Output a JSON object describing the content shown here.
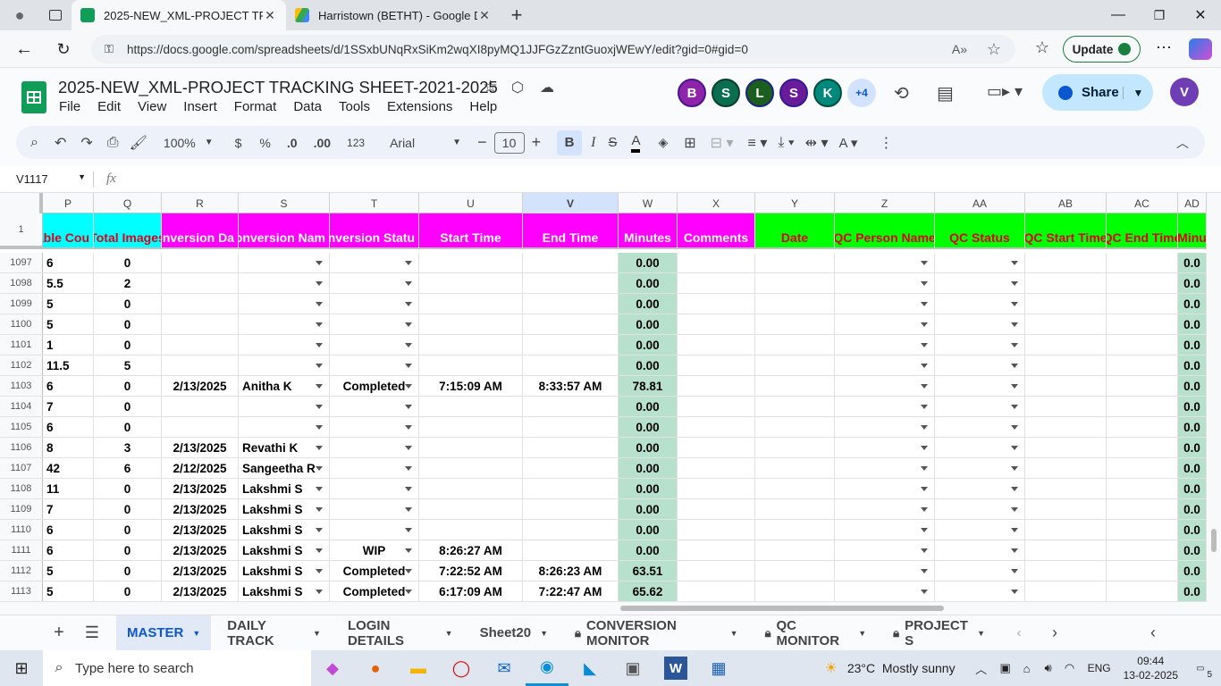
{
  "browser": {
    "tabs": [
      {
        "title": "2025-NEW_XML-PROJECT TRACK",
        "active": true
      },
      {
        "title": "Harristown (BETHT) - Google Driv",
        "active": false
      }
    ],
    "url": "https://docs.google.com/spreadsheets/d/1SSxbUNqRxSiKm2wqXI8pyMQ1JJFGzZzntGuoxjWEwY/edit?gid=0#gid=0",
    "update_label": "Update"
  },
  "doc": {
    "title": "2025-NEW_XML-PROJECT TRACKING SHEET-2021-2025",
    "menu": [
      "File",
      "Edit",
      "View",
      "Insert",
      "Format",
      "Data",
      "Tools",
      "Extensions",
      "Help"
    ],
    "collaborators": [
      {
        "initial": "B",
        "color": "#8e24aa"
      },
      {
        "initial": "S",
        "color": "#0b6e4f"
      },
      {
        "initial": "L",
        "color": "#1b5e20"
      },
      {
        "initial": "S",
        "color": "#6a1b9a"
      },
      {
        "initial": "K",
        "color": "#00897b"
      }
    ],
    "more_collaborators": "+4",
    "share_label": "Share",
    "user_initial": "V"
  },
  "toolbar": {
    "zoom": "100%",
    "currency": "$",
    "percent": "%",
    "dec_less": ".0",
    "dec_more": ".00",
    "number_format": "123",
    "font": "Arial",
    "font_size": "10"
  },
  "formula_bar": {
    "cell_ref": "V1117",
    "fx": "fx",
    "value": ""
  },
  "grid": {
    "columns": [
      "P",
      "Q",
      "R",
      "S",
      "T",
      "U",
      "V",
      "W",
      "X",
      "Y",
      "Z",
      "AA",
      "AB",
      "AC",
      "AD"
    ],
    "header_row_num": "1",
    "headers": [
      "able Cou",
      "Total Images",
      "onversion Da",
      "onversion Nam",
      "onversion Statu",
      "Start Time",
      "End Time",
      "Minutes",
      "Comments",
      "Date",
      "QC Person Name",
      "QC Status",
      "QC Start Time",
      "QC End Time",
      "Minu"
    ],
    "rows": [
      {
        "n": "1097",
        "P": "6",
        "Q": "0",
        "R": "",
        "S": "",
        "T": "",
        "U": "",
        "V": "",
        "W": "0.00",
        "AD": "0.0"
      },
      {
        "n": "1098",
        "P": "5.5",
        "Q": "2",
        "R": "",
        "S": "",
        "T": "",
        "U": "",
        "V": "",
        "W": "0.00",
        "AD": "0.0"
      },
      {
        "n": "1099",
        "P": "5",
        "Q": "0",
        "R": "",
        "S": "",
        "T": "",
        "U": "",
        "V": "",
        "W": "0.00",
        "AD": "0.0"
      },
      {
        "n": "1100",
        "P": "5",
        "Q": "0",
        "R": "",
        "S": "",
        "T": "",
        "U": "",
        "V": "",
        "W": "0.00",
        "AD": "0.0"
      },
      {
        "n": "1101",
        "P": "1",
        "Q": "0",
        "R": "",
        "S": "",
        "T": "",
        "U": "",
        "V": "",
        "W": "0.00",
        "AD": "0.0"
      },
      {
        "n": "1102",
        "P": "11.5",
        "Q": "5",
        "R": "",
        "S": "",
        "T": "",
        "U": "",
        "V": "",
        "W": "0.00",
        "AD": "0.0"
      },
      {
        "n": "1103",
        "P": "6",
        "Q": "0",
        "R": "2/13/2025",
        "S": "Anitha K",
        "T": "Completed",
        "U": "7:15:09 AM",
        "V": "8:33:57 AM",
        "W": "78.81",
        "AD": "0.0"
      },
      {
        "n": "1104",
        "P": "7",
        "Q": "0",
        "R": "",
        "S": "",
        "T": "",
        "U": "",
        "V": "",
        "W": "0.00",
        "AD": "0.0"
      },
      {
        "n": "1105",
        "P": "6",
        "Q": "0",
        "R": "",
        "S": "",
        "T": "",
        "U": "",
        "V": "",
        "W": "0.00",
        "AD": "0.0"
      },
      {
        "n": "1106",
        "P": "8",
        "Q": "3",
        "R": "2/13/2025",
        "S": "Revathi K",
        "T": "",
        "U": "",
        "V": "",
        "W": "0.00",
        "AD": "0.0"
      },
      {
        "n": "1107",
        "P": "42",
        "Q": "6",
        "R": "2/12/2025",
        "S": "Sangeetha R",
        "T": "",
        "U": "",
        "V": "",
        "W": "0.00",
        "AD": "0.0"
      },
      {
        "n": "1108",
        "P": "11",
        "Q": "0",
        "R": "2/13/2025",
        "S": "Lakshmi S",
        "T": "",
        "U": "",
        "V": "",
        "W": "0.00",
        "AD": "0.0"
      },
      {
        "n": "1109",
        "P": "7",
        "Q": "0",
        "R": "2/13/2025",
        "S": "Lakshmi S",
        "T": "",
        "U": "",
        "V": "",
        "W": "0.00",
        "AD": "0.0"
      },
      {
        "n": "1110",
        "P": "6",
        "Q": "0",
        "R": "2/13/2025",
        "S": "Lakshmi S",
        "T": "",
        "U": "",
        "V": "",
        "W": "0.00",
        "AD": "0.0"
      },
      {
        "n": "1111",
        "P": "6",
        "Q": "0",
        "R": "2/13/2025",
        "S": "Lakshmi S",
        "T": "WIP",
        "U": "8:26:27 AM",
        "V": "",
        "W": "0.00",
        "AD": "0.0"
      },
      {
        "n": "1112",
        "P": "5",
        "Q": "0",
        "R": "2/13/2025",
        "S": "Lakshmi S",
        "T": "Completed",
        "U": "7:22:52 AM",
        "V": "8:26:23 AM",
        "W": "63.51",
        "AD": "0.0"
      },
      {
        "n": "1113",
        "P": "5",
        "Q": "0",
        "R": "2/13/2025",
        "S": "Lakshmi S",
        "T": "Completed",
        "U": "6:17:09 AM",
        "V": "7:22:47 AM",
        "W": "65.62",
        "AD": "0.0"
      }
    ]
  },
  "sheets": [
    "MASTER",
    "DAILY TRACK",
    "LOGIN DETAILS",
    "Sheet20",
    "CONVERSION MONITOR",
    "QC MONITOR",
    "PROJECT S"
  ],
  "locked_sheets": [
    false,
    false,
    false,
    false,
    true,
    true,
    true
  ],
  "taskbar": {
    "search_placeholder": "Type here to search",
    "weather": "23°C  Mostly sunny",
    "lang": "ENG",
    "time": "09:44",
    "date": "13-02-2025",
    "notif_count": "5"
  },
  "colors": {
    "cyan": "#00ffff",
    "magenta": "#ff00ff",
    "green": "#00ff00",
    "minutes_fill": "#b7e1cd",
    "header_text_red": "#e0001b",
    "selected_col": "#d3e3fd"
  }
}
